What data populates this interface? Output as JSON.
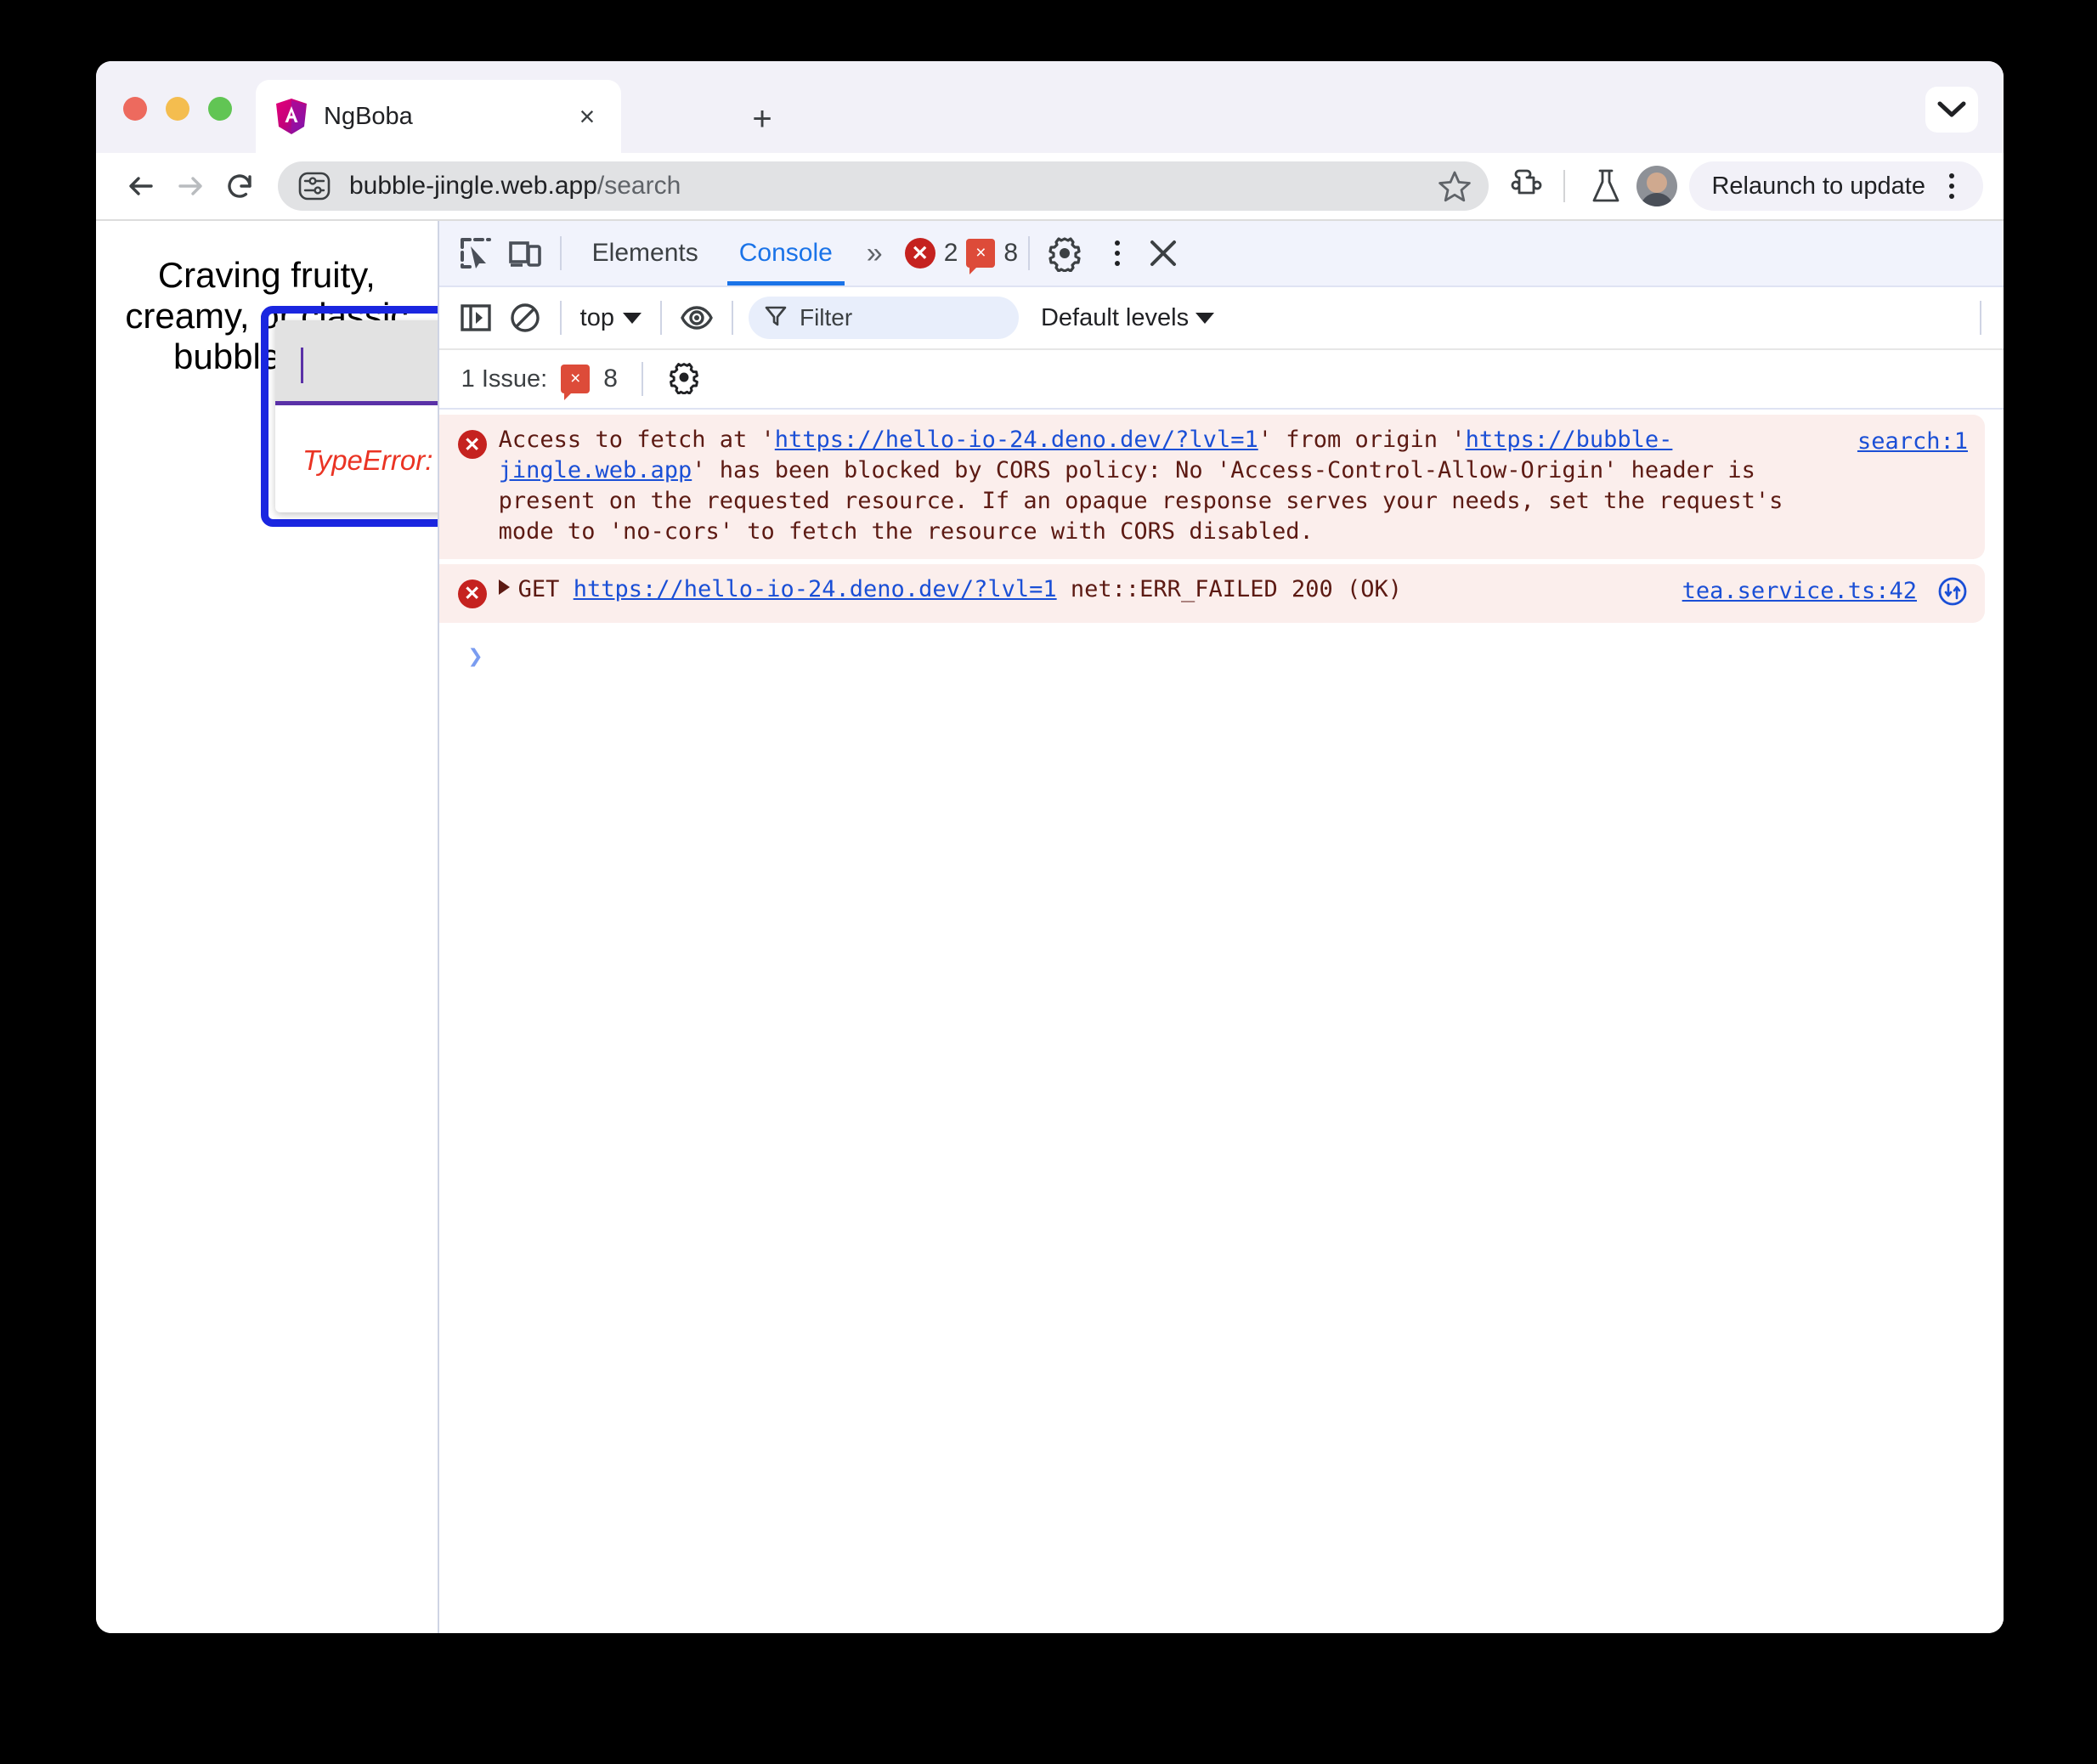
{
  "window": {
    "traffic_lights": [
      "close",
      "minimize",
      "maximize"
    ]
  },
  "tabstrip": {
    "tab_title": "NgBoba",
    "close_label": "×",
    "new_tab_label": "+",
    "chevron_icon": "chevron-down-icon"
  },
  "toolbar": {
    "back_icon": "arrow-left-icon",
    "forward_icon": "arrow-right-icon",
    "reload_icon": "reload-icon",
    "site_info_icon": "tune-icon",
    "url_host": "bubble-jingle.web.app",
    "url_path": "/search",
    "star_icon": "star-outline-icon",
    "extensions_icon": "extension-puzzle-icon",
    "experiments_icon": "flask-icon",
    "avatar_icon": "profile-avatar",
    "relaunch_label": "Relaunch to update",
    "menu_icon": "kebab-menu-icon"
  },
  "page": {
    "heading": "Craving fruity, creamy, or classic bubble tea?",
    "search": {
      "value": "",
      "placeholder": "",
      "error": "TypeError: Failed to fetch"
    },
    "illustration": "boba-cup-illustration",
    "highlight_color": "#1a26e0",
    "error_color": "#ea3323",
    "underline_color": "#5a31a7"
  },
  "devtools": {
    "inspect_icon": "inspect-element-icon",
    "device_icon": "device-toolbar-icon",
    "tabs": [
      {
        "label": "Elements",
        "active": false
      },
      {
        "label": "Console",
        "active": true
      }
    ],
    "more_tabs_icon": "chevron-double-right-icon",
    "error_badge": {
      "icon": "error-circle-icon",
      "glyph": "✕",
      "count": "2"
    },
    "issue_badge": {
      "icon": "issue-square-icon",
      "glyph": "×",
      "count": "8"
    },
    "settings_icon": "gear-icon",
    "menu_icon": "kebab-menu-icon",
    "close_icon": "close-icon",
    "filterbar": {
      "sidebar_icon": "show-console-sidebar-icon",
      "clear_icon": "clear-console-icon",
      "context": "top",
      "eye_icon": "live-expression-eye-icon",
      "filter_icon": "filter-funnel-icon",
      "filter_placeholder": "Filter",
      "filter_value": "",
      "levels_label": "Default levels"
    },
    "issuebar": {
      "label": "1 Issue:",
      "badge_glyph": "×",
      "count": "8",
      "settings_icon": "gear-icon"
    },
    "messages": [
      {
        "level": "error",
        "glyph": "✕",
        "source": "search:1",
        "segments": [
          {
            "t": "Access to fetch at '",
            "link": false
          },
          {
            "t": "https://hello-io-24.deno.dev/?lvl=1",
            "link": true
          },
          {
            "t": "' from origin '",
            "link": false
          },
          {
            "t": "https://bubble-jingle.web.app",
            "link": true
          },
          {
            "t": "' has been blocked by CORS policy: No 'Access-Control-Allow-Origin' header is present on the requested resource. If an opaque response serves your needs, set the request's mode to 'no-cors' to fetch the resource with CORS disabled.",
            "link": false
          }
        ]
      },
      {
        "level": "error",
        "glyph": "✕",
        "source": "tea.service.ts:42",
        "expandable": true,
        "request_icon": "network-request-icon",
        "segments": [
          {
            "t": "GET ",
            "link": false
          },
          {
            "t": "https://hello-io-24.deno.dev/?lvl=1",
            "link": true
          },
          {
            "t": " net::ERR_FAILED 200 (OK)",
            "link": false
          }
        ]
      }
    ],
    "prompt_glyph": "❯"
  }
}
